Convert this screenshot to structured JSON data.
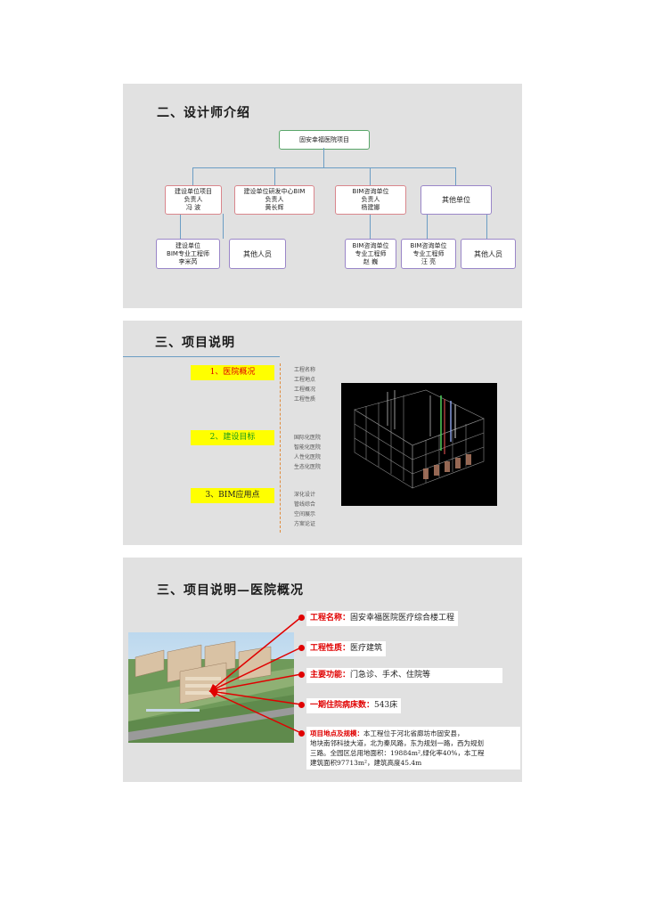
{
  "slide1": {
    "title": "二、设计师介绍",
    "root": "固安幸福医院项目",
    "level1": [
      {
        "lines": [
          "建设单位项目",
          "负责人",
          "冯  波"
        ]
      },
      {
        "lines": [
          "建设单位研发中心BIM",
          "负责人",
          "黄长辉"
        ]
      },
      {
        "lines": [
          "BIM咨询单位",
          "负责人",
          "杨建娜"
        ]
      },
      {
        "lines": [
          "其他单位"
        ]
      }
    ],
    "level2": [
      {
        "lines": [
          "建设单位",
          "BIM专业工程师",
          "李米芮"
        ]
      },
      {
        "lines": [
          "其他人员"
        ]
      },
      {
        "lines": [
          "BIM咨询单位",
          "专业工程师",
          "赵  巍"
        ]
      },
      {
        "lines": [
          "BIM咨询单位",
          "专业工程师",
          "汪  亮"
        ]
      },
      {
        "lines": [
          "其他人员"
        ]
      }
    ]
  },
  "slide2": {
    "title": "三、项目说明",
    "items": [
      {
        "label": "1、医院概况",
        "color": "#e00000",
        "desc": [
          "工程名称",
          "工程地点",
          "工程概况",
          "工程性质"
        ]
      },
      {
        "label": "2、建设目标",
        "color": "#1a9a1a",
        "desc": [
          "国际化医院",
          "智能化医院",
          "人性化医院",
          "生态化医院"
        ]
      },
      {
        "label": "3、BIM应用点",
        "color": "#222222",
        "desc": [
          "深化设计",
          "管线综合",
          "空间展示",
          "方案论证"
        ]
      }
    ]
  },
  "slide3": {
    "title": "三、项目说明—医院概况",
    "callouts": [
      {
        "key": "工程名称：",
        "value": "固安幸福医院医疗综合楼工程"
      },
      {
        "key": "工程性质：",
        "value": "医疗建筑"
      },
      {
        "key": "主要功能：",
        "value": "门急诊、手术、住院等"
      },
      {
        "key": "一期住院病床数：",
        "value": "543床"
      },
      {
        "key": "项目地点及规模：",
        "value": "本工程位于河北省廊坊市固安县，",
        "extra": [
          "地块南邻科技大道，北为秦风路，东为规划一路，西为规划",
          "三路。全园区总用地面积：19884m²,绿化率40%，本工程",
          "建筑面积97713m²，建筑高度45.4m"
        ]
      }
    ]
  },
  "colors": {
    "accent": "#e00000",
    "line": "#6b9dc4",
    "highlight": "#ffff00"
  }
}
